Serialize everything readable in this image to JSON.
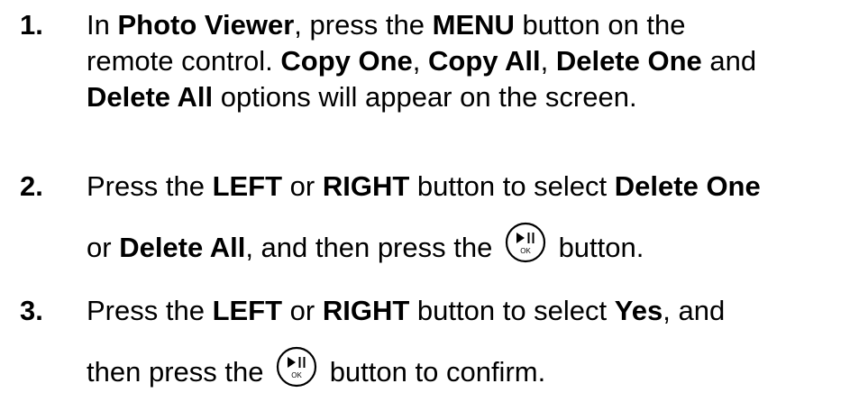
{
  "steps": [
    {
      "number": "1.",
      "lines": [
        [
          {
            "t": "In ",
            "b": false
          },
          {
            "t": "Photo Viewer",
            "b": true
          },
          {
            "t": ", press the ",
            "b": false
          },
          {
            "t": "MENU",
            "b": true
          },
          {
            "t": " button on the",
            "b": false
          }
        ],
        [
          {
            "t": "remote control. ",
            "b": false
          },
          {
            "t": "Copy One",
            "b": true
          },
          {
            "t": ", ",
            "b": false
          },
          {
            "t": "Copy All",
            "b": true
          },
          {
            "t": ", ",
            "b": false
          },
          {
            "t": "Delete One",
            "b": true
          },
          {
            "t": " and",
            "b": false
          }
        ],
        [
          {
            "t": "Delete All",
            "b": true
          },
          {
            "t": " options will appear on the screen.",
            "b": false
          }
        ]
      ]
    },
    {
      "number": "2.",
      "lines": [
        [
          {
            "t": "Press the ",
            "b": false
          },
          {
            "t": "LEFT",
            "b": true
          },
          {
            "t": " or ",
            "b": false
          },
          {
            "t": "RIGHT",
            "b": true
          },
          {
            "t": " button to select ",
            "b": false
          },
          {
            "t": "Delete One",
            "b": true
          }
        ],
        [
          {
            "t": "or ",
            "b": false
          },
          {
            "t": "Delete All",
            "b": true
          },
          {
            "t": ", and then press the ",
            "b": false
          },
          {
            "icon": "play-pause-ok-button-icon"
          },
          {
            "t": " button.",
            "b": false
          }
        ]
      ]
    },
    {
      "number": "3.",
      "lines": [
        [
          {
            "t": "Press the ",
            "b": false
          },
          {
            "t": "LEFT",
            "b": true
          },
          {
            "t": " or ",
            "b": false
          },
          {
            "t": "RIGHT",
            "b": true
          },
          {
            "t": " button to select ",
            "b": false
          },
          {
            "t": "Yes",
            "b": true
          },
          {
            "t": ", and",
            "b": false
          }
        ],
        [
          {
            "t": "then press the ",
            "b": false
          },
          {
            "icon": "play-pause-ok-button-icon"
          },
          {
            "t": " button to confirm.",
            "b": false
          }
        ]
      ]
    }
  ],
  "ok_button_icon": {
    "name": "play-pause-ok-button-icon",
    "label": "OK",
    "color": "#000000"
  }
}
